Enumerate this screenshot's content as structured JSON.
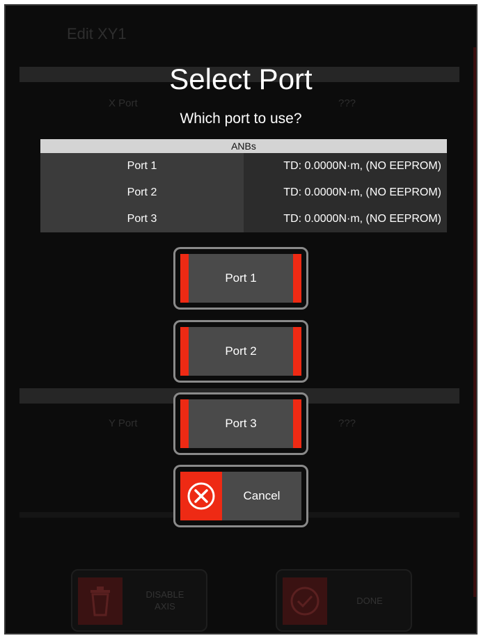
{
  "background": {
    "title": "Edit XY1",
    "x_port_label": "X Port",
    "x_port_value": "???",
    "y_port_label": "Y Port",
    "y_port_value": "???",
    "disable_button_label": "DISABLE\nAXIS",
    "done_button_label": "DONE"
  },
  "dialog": {
    "title": "Select Port",
    "subtitle": "Which port to use?",
    "table": {
      "header": "ANBs",
      "rows": [
        {
          "port": "Port 1",
          "info": "TD: 0.0000N·m, (NO EEPROM)"
        },
        {
          "port": "Port 2",
          "info": "TD: 0.0000N·m, (NO EEPROM)"
        },
        {
          "port": "Port 3",
          "info": "TD: 0.0000N·m, (NO EEPROM)"
        }
      ]
    },
    "buttons": {
      "port1": "Port 1",
      "port2": "Port 2",
      "port3": "Port 3",
      "cancel": "Cancel"
    }
  },
  "colors": {
    "accent": "#ee2a14",
    "dialog_text": "#ffffff",
    "table_header_bg": "#d4d4d4"
  },
  "icons": {
    "cancel": "close-circle-icon",
    "disable": "trash-icon",
    "done": "check-circle-icon"
  }
}
